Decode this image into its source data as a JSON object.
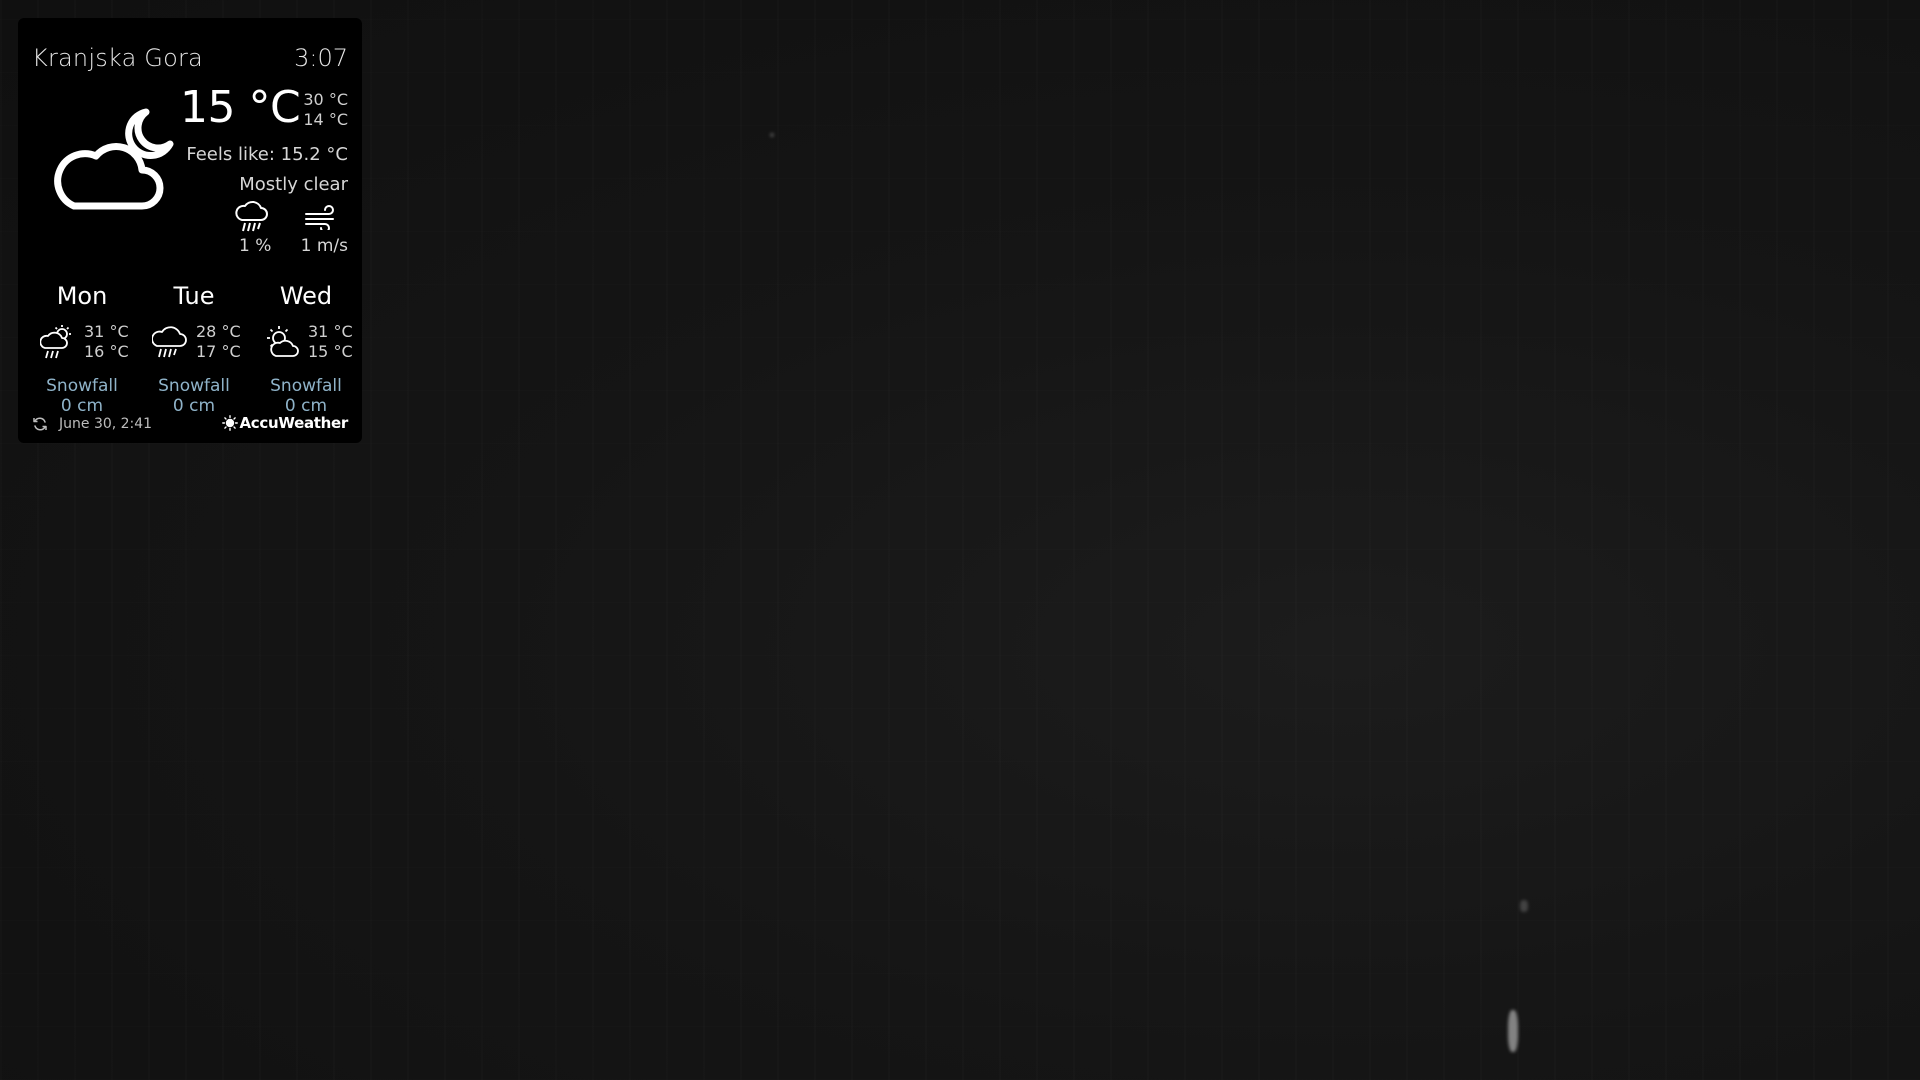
{
  "widget": {
    "location": "Kranjska Gora",
    "time": "3:07",
    "current": {
      "temperature": "15 °C",
      "high": "30 °C",
      "low": "14 °C",
      "feels_like": "Feels like: 15.2 °C",
      "condition": "Mostly clear",
      "icon": "cloud-moon-icon",
      "precipitation": "1 %",
      "precipitation_icon": "rain-icon",
      "wind": "1 m/s",
      "wind_icon": "wind-icon"
    },
    "forecast": [
      {
        "day": "Mon",
        "high": "31 °C",
        "low": "16 °C",
        "icon": "sun-rain-icon",
        "snow_label": "Snowfall",
        "snow_value": "0 cm"
      },
      {
        "day": "Tue",
        "high": "28 °C",
        "low": "17 °C",
        "icon": "rain-icon",
        "snow_label": "Snowfall",
        "snow_value": "0 cm"
      },
      {
        "day": "Wed",
        "high": "31 °C",
        "low": "15 °C",
        "icon": "sun-cloud-icon",
        "snow_label": "Snowfall",
        "snow_value": "0 cm"
      }
    ],
    "updated": "June 30, 2:41",
    "provider": "AccuWeather"
  },
  "colors": {
    "widget_background": "#000000",
    "snow_text": "#8fb3c9",
    "page_background": "#141414"
  }
}
